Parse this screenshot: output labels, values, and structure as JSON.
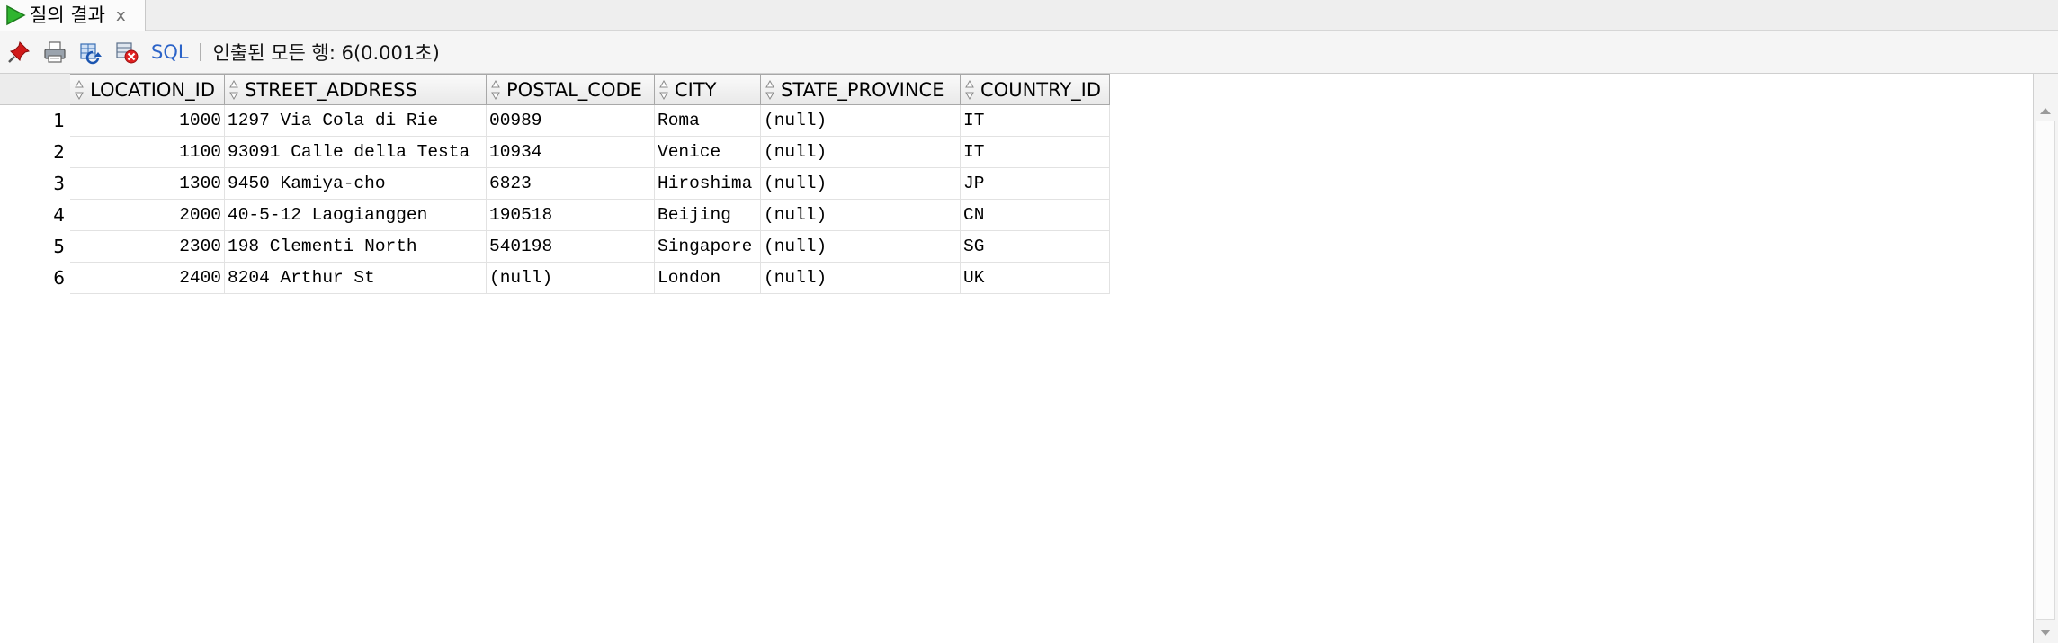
{
  "tab": {
    "label": "질의 결과",
    "close": "x"
  },
  "toolbar": {
    "buttons": [
      {
        "name": "pin-icon"
      },
      {
        "name": "print-icon"
      },
      {
        "name": "refresh-icon"
      },
      {
        "name": "cancel-icon"
      }
    ],
    "sql_label": "SQL",
    "status": "인출된 모든 행: 6(0.001초)"
  },
  "grid": {
    "columns": [
      {
        "key": "location_id",
        "label": "LOCATION_ID",
        "align": "right"
      },
      {
        "key": "street_address",
        "label": "STREET_ADDRESS",
        "align": "left"
      },
      {
        "key": "postal_code",
        "label": "POSTAL_CODE",
        "align": "left"
      },
      {
        "key": "city",
        "label": "CITY",
        "align": "left"
      },
      {
        "key": "state_province",
        "label": "STATE_PROVINCE",
        "align": "left"
      },
      {
        "key": "country_id",
        "label": "COUNTRY_ID",
        "align": "left"
      }
    ],
    "rows": [
      {
        "num": "1",
        "location_id": "1000",
        "street_address": "1297 Via Cola di Rie",
        "postal_code": "00989",
        "city": "Roma",
        "state_province": "(null)",
        "country_id": "IT"
      },
      {
        "num": "2",
        "location_id": "1100",
        "street_address": "93091 Calle della Testa",
        "postal_code": "10934",
        "city": "Venice",
        "state_province": "(null)",
        "country_id": "IT"
      },
      {
        "num": "3",
        "location_id": "1300",
        "street_address": "9450 Kamiya-cho",
        "postal_code": "6823",
        "city": "Hiroshima",
        "state_province": "(null)",
        "country_id": "JP"
      },
      {
        "num": "4",
        "location_id": "2000",
        "street_address": "40-5-12 Laogianggen",
        "postal_code": "190518",
        "city": "Beijing",
        "state_province": "(null)",
        "country_id": "CN"
      },
      {
        "num": "5",
        "location_id": "2300",
        "street_address": "198 Clementi North",
        "postal_code": "540198",
        "city": "Singapore",
        "state_province": "(null)",
        "country_id": "SG"
      },
      {
        "num": "6",
        "location_id": "2400",
        "street_address": "8204 Arthur St",
        "postal_code": "(null)",
        "city": "London",
        "state_province": "(null)",
        "country_id": "UK"
      }
    ]
  },
  "colors": {
    "run_icon": "#2fb52f",
    "sql_link": "#2b63c8",
    "pin": "#d11a1a"
  }
}
